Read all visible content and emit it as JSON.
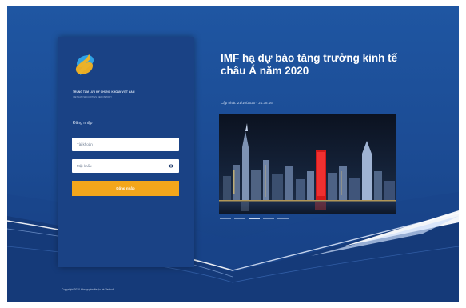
{
  "colors": {
    "background": "#1b4a92",
    "card": "#1a4285",
    "accent": "#f3a61b",
    "input_bg": "#ffffff"
  },
  "brand": {
    "logo_icon": "s-swirl-logo-icon",
    "org_name": "TRUNG TÂM LƯU KÝ CHỨNG KHOÁN VIỆT NAM",
    "org_name_en": "VIETNAM SECURITIES DEPOSITORY"
  },
  "login": {
    "heading": "Đăng nhập",
    "username_placeholder": "Tài khoản",
    "password_placeholder": "Mật khẩu",
    "show_password_icon": "eye-icon",
    "submit_label": "Đăng nhập"
  },
  "news": {
    "title": "IMF hạ dự báo tăng trưởng kinh tế châu Á năm 2020",
    "date": "Cập nhật: 21/10/2020 - 21:38:16",
    "image": "city-night-skyline",
    "carousel": {
      "count": 5,
      "active_index": 2
    }
  },
  "footer": {
    "copyright": "Copyright 2020 bản quyền thuộc về Vsdsoft"
  }
}
